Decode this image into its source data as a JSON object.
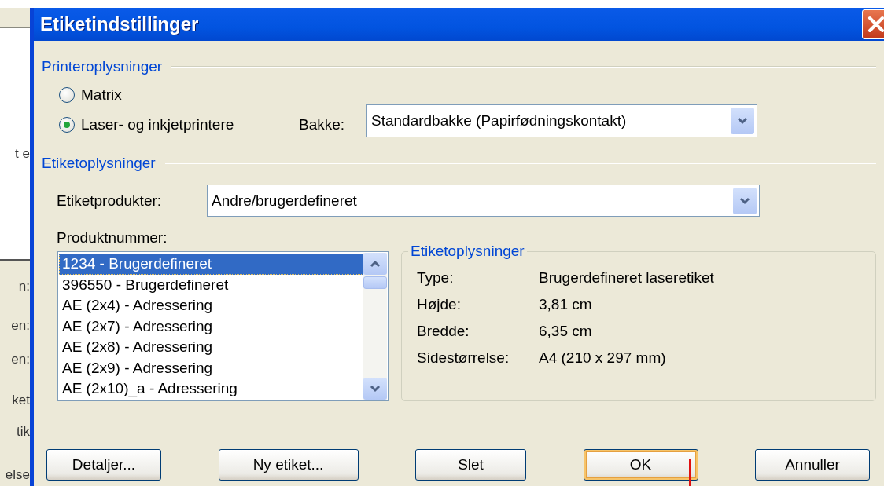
{
  "background_window": {
    "fragments": [
      "t e",
      "n:",
      "en:",
      "en:",
      "ket",
      "tik",
      "else"
    ]
  },
  "window": {
    "title": "Etiketindstillinger"
  },
  "printer_info": {
    "heading": "Printeroplysninger",
    "options": [
      {
        "label": "Matrix",
        "selected": false
      },
      {
        "label": "Laser- og inkjetprintere",
        "selected": true
      }
    ],
    "tray": {
      "label": "Bakke:",
      "value": "Standardbakke (Papirfødningskontakt)"
    }
  },
  "label_info": {
    "heading": "Etiketoplysninger",
    "products": {
      "label": "Etiketprodukter:",
      "value": "Andre/brugerdefineret"
    },
    "product_number": {
      "label": "Produktnummer:",
      "items": [
        {
          "label": "1234 - Brugerdefineret",
          "selected": true
        },
        {
          "label": "396550 - Brugerdefineret",
          "selected": false
        },
        {
          "label": "AE (2x4) - Adressering",
          "selected": false
        },
        {
          "label": "AE (2x7) - Adressering",
          "selected": false
        },
        {
          "label": "AE (2x8) - Adressering",
          "selected": false
        },
        {
          "label": "AE (2x9) - Adressering",
          "selected": false
        },
        {
          "label": "AE (2x10)_a - Adressering",
          "selected": false
        }
      ]
    },
    "details": {
      "heading": "Etiketoplysninger",
      "rows": [
        {
          "label": "Type:",
          "value": "Brugerdefineret laseretiket"
        },
        {
          "label": "Højde:",
          "value": "3,81 cm"
        },
        {
          "label": "Bredde:",
          "value": "6,35 cm"
        },
        {
          "label": "Sidestørrelse:",
          "value": "A4 (210 x 297 mm)"
        }
      ]
    }
  },
  "buttons": [
    {
      "label": "Detaljer...",
      "default": false
    },
    {
      "label": "Ny etiket...",
      "default": false
    },
    {
      "label": "Slet",
      "default": false
    },
    {
      "label": "OK",
      "default": true
    },
    {
      "label": "Annuller",
      "default": false
    }
  ]
}
